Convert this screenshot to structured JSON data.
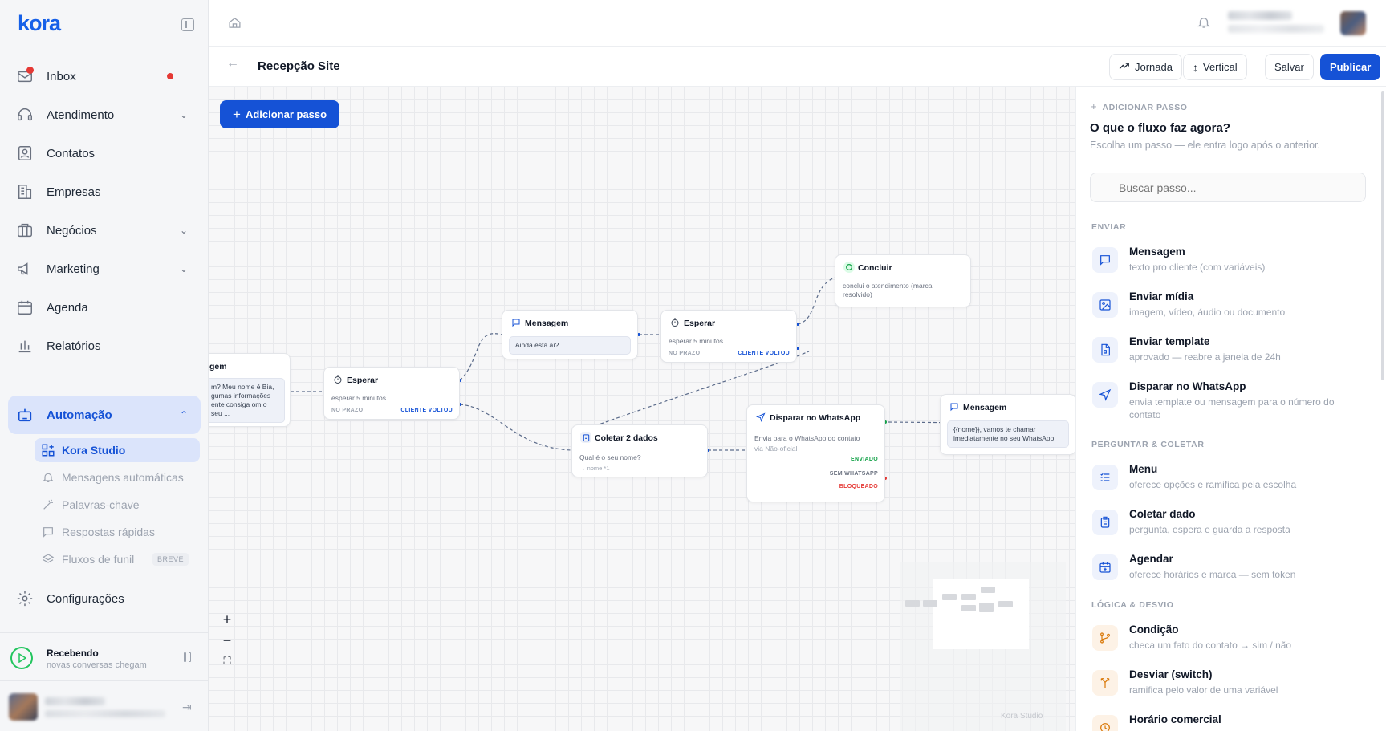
{
  "app": {
    "logo": "kora"
  },
  "sidebar": {
    "items": [
      {
        "label": "Inbox",
        "icon": "inbox-icon",
        "chevron": false,
        "dot": true
      },
      {
        "label": "Atendimento",
        "icon": "headset-icon",
        "chevron": true
      },
      {
        "label": "Contatos",
        "icon": "contacts-icon",
        "chevron": false
      },
      {
        "label": "Empresas",
        "icon": "building-icon",
        "chevron": false
      },
      {
        "label": "Negócios",
        "icon": "briefcase-icon",
        "chevron": true
      },
      {
        "label": "Marketing",
        "icon": "megaphone-icon",
        "chevron": true
      },
      {
        "label": "Agenda",
        "icon": "calendar-icon",
        "chevron": false
      },
      {
        "label": "Relatórios",
        "icon": "chart-icon",
        "chevron": false
      },
      {
        "label": "Automação",
        "icon": "robot-icon",
        "chevron": true,
        "active": true
      }
    ],
    "subitems": [
      {
        "label": "Kora Studio",
        "icon": "studio-icon",
        "active": true
      },
      {
        "label": "Mensagens automáticas",
        "icon": "bell-icon"
      },
      {
        "label": "Palavras-chave",
        "icon": "wand-icon"
      },
      {
        "label": "Respostas rápidas",
        "icon": "chat-icon"
      },
      {
        "label": "Fluxos de funil",
        "icon": "layers-icon",
        "badge": "BREVE"
      }
    ],
    "settings": "Configurações",
    "status": {
      "title": "Recebendo",
      "subtitle": "novas conversas chegam"
    }
  },
  "header": {
    "title": "Recepção Site",
    "buttons": {
      "jornada": "Jornada",
      "vertical": "Vertical",
      "salvar": "Salvar",
      "publicar": "Publicar"
    }
  },
  "canvas": {
    "add_step": "Adicionar passo",
    "watermark": "Kora Studio",
    "nodes": {
      "n1": {
        "title": "gem",
        "text": "m? Meu nome é Bia, gumas informações ente consiga om o seu ..."
      },
      "n2": {
        "title": "Esperar",
        "text": "esperar 5 minutos",
        "tag_left": "NO PRAZO",
        "tag_right": "CLIENTE VOLTOU"
      },
      "n3": {
        "title": "Mensagem",
        "text": "Ainda está aí?"
      },
      "n4": {
        "title": "Esperar",
        "text": "esperar 5 minutos",
        "tag_left": "NO PRAZO",
        "tag_right": "CLIENTE VOLTOU"
      },
      "n5": {
        "title": "Concluir",
        "text": "conclui o atendimento (marca resolvido)"
      },
      "n6": {
        "title": "Coletar 2 dados",
        "text": "Qual é o seu nome?",
        "text2": "→ nome *1"
      },
      "n7": {
        "title": "Disparar no WhatsApp",
        "text": "Envia para o WhatsApp do contato",
        "text2": "via Não-oficial",
        "out1": "ENVIADO",
        "out2": "SEM WHATSAPP",
        "out3": "BLOQUEADO"
      },
      "n8": {
        "title": "Mensagem",
        "text": "{{nome}}, vamos te chamar imediatamente no seu WhatsApp."
      }
    }
  },
  "panel": {
    "kicker": "ADICIONAR PASSO",
    "title": "O que o fluxo faz agora?",
    "subtitle": "Escolha um passo — ele entra logo após o anterior.",
    "search_placeholder": "Buscar passo...",
    "sections": [
      {
        "title": "ENVIAR",
        "items": [
          {
            "title": "Mensagem",
            "desc": "texto pro cliente (com variáveis)",
            "icon": "message-icon"
          },
          {
            "title": "Enviar mídia",
            "desc": "imagem, vídeo, áudio ou documento",
            "icon": "image-icon"
          },
          {
            "title": "Enviar template",
            "desc": "aprovado — reabre a janela de 24h",
            "icon": "template-icon"
          },
          {
            "title": "Disparar no WhatsApp",
            "desc": "envia template ou mensagem para o número do contato",
            "icon": "send-icon"
          }
        ]
      },
      {
        "title": "PERGUNTAR & COLETAR",
        "items": [
          {
            "title": "Menu",
            "desc": "oferece opções e ramifica pela escolha",
            "icon": "menu-list-icon"
          },
          {
            "title": "Coletar dado",
            "desc": "pergunta, espera e guarda a resposta",
            "icon": "clipboard-icon"
          },
          {
            "title": "Agendar",
            "desc": "oferece horários e marca — sem token",
            "icon": "calendar-plus-icon"
          }
        ]
      },
      {
        "title": "LÓGICA & DESVIO",
        "items": [
          {
            "title": "Condição",
            "desc": "checa um fato do contato → sim / não",
            "icon": "branch-icon"
          },
          {
            "title": "Desviar (switch)",
            "desc": "ramifica pelo valor de uma variável",
            "icon": "switch-icon"
          },
          {
            "title": "Horário comercial",
            "desc": "",
            "icon": "clock-icon"
          }
        ]
      }
    ]
  },
  "colors": {
    "accent": "#1552d6",
    "accent_light": "#dbe4fb",
    "success": "#16a34a",
    "danger": "#e53935"
  }
}
